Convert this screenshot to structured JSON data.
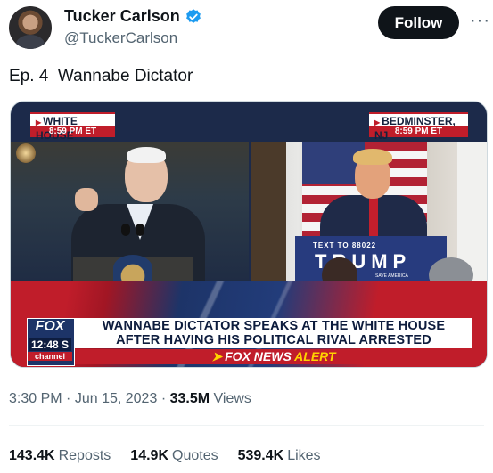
{
  "author": {
    "name": "Tucker Carlson",
    "handle": "@TuckerCarlson",
    "verified_icon": "verified-badge-icon",
    "avatar_icon": "avatar"
  },
  "header": {
    "follow_label": "Follow",
    "more_label": "···"
  },
  "tweet": {
    "text": "Ep. 4  Wannabe Dictator"
  },
  "media": {
    "location_left": "WHITE HOUSE",
    "time_left": "8:59 PM ET",
    "location_right": "BEDMINSTER, NJ",
    "time_right": "8:59 PM ET",
    "sign_top": "TEXT TO 88022",
    "sign_big": "TRUMP",
    "sign_small": "SAVE AMERICA",
    "bug_logo": "FOX",
    "bug_time": "12:48 S",
    "bug_channel": "channel",
    "headline_line1": "WANNABE DICTATOR SPEAKS AT THE WHITE HOUSE",
    "headline_line2": "AFTER HAVING HIS POLITICAL RIVAL ARRESTED",
    "ticker_white": "FOX NEWS",
    "ticker_yellow": "ALERT"
  },
  "meta": {
    "time": "3:30 PM",
    "separator": "·",
    "date": "Jun 15, 2023",
    "views_count": "33.5M",
    "views_label": "Views"
  },
  "stats": {
    "reposts_count": "143.4K",
    "reposts_label": "Reposts",
    "quotes_count": "14.9K",
    "quotes_label": "Quotes",
    "likes_count": "539.4K",
    "likes_label": "Likes"
  },
  "colors": {
    "brand_black": "#0f1419",
    "muted": "#536471",
    "verified_blue": "#1d9bf0",
    "fox_red": "#c01d2a",
    "fox_blue": "#1d3468",
    "alert_yellow": "#ffd200"
  }
}
